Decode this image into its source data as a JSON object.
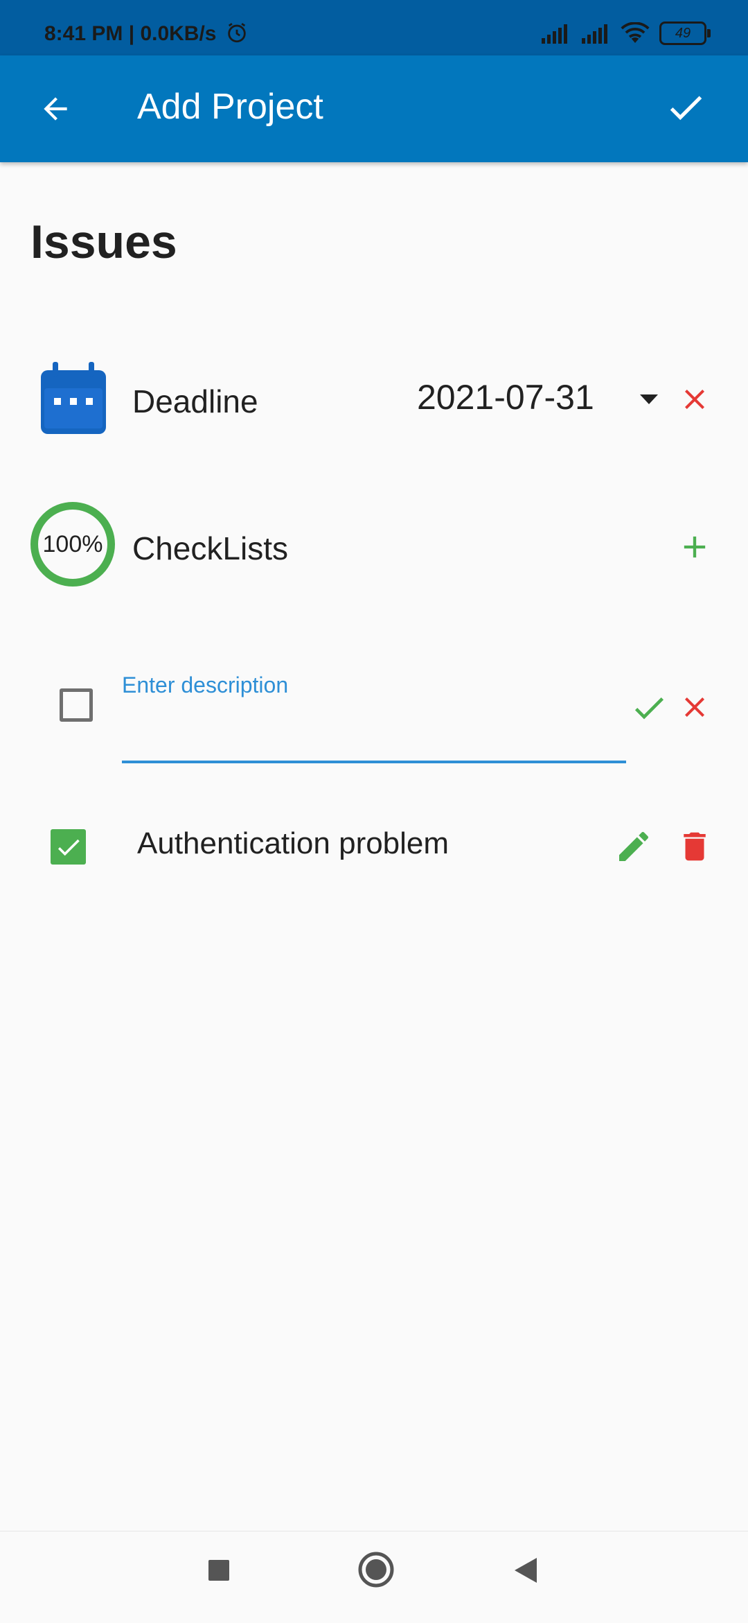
{
  "status_bar": {
    "time_text": "8:41 PM | 0.0KB/s",
    "battery": "49",
    "icons": [
      "alarm-icon",
      "signal-icon",
      "signal-icon",
      "wifi-icon",
      "battery-icon"
    ]
  },
  "app_bar": {
    "title": "Add Project",
    "back_icon": "arrow-back-icon",
    "confirm_icon": "check-icon"
  },
  "page": {
    "heading": "Issues"
  },
  "deadline": {
    "label": "Deadline",
    "value": "2021-07-31",
    "icon": "calendar-icon"
  },
  "checklists": {
    "label": "CheckLists",
    "progress_text": "100%",
    "progress_fraction": 1.0
  },
  "new_item": {
    "label": "Enter description",
    "value": "",
    "checked": false
  },
  "items": [
    {
      "text": "Authentication problem",
      "checked": true
    }
  ],
  "colors": {
    "app_bar": "#0277bd",
    "status_bar": "#025da0",
    "green": "#4caf50",
    "red": "#e53935",
    "input_accent": "#2e8fd6",
    "calendar_blue": "#1565c0"
  }
}
